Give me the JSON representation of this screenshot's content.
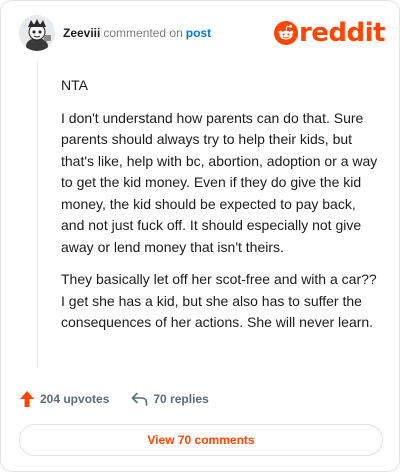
{
  "header": {
    "username": "Zeeviii",
    "action_text": "commented on",
    "post_link": "post",
    "brand": "reddit"
  },
  "comment": {
    "paragraphs": [
      "NTA",
      "I don't understand how parents can do that. Sure parents should always try to help their kids, but that's like, help with bc, abortion, adoption or a way to get the kid money. Even if they do give the kid money, the kid should be expected to pay back, and not just fuck off. It should especially not give away or lend money that isn't theirs.",
      "They basically let off her scot-free and with a car?? I get she has a kid, but she also has to suffer the consequences of her actions. She will never learn."
    ]
  },
  "stats": {
    "upvotes": "204 upvotes",
    "replies": "70 replies"
  },
  "footer": {
    "view_comments": "View 70 comments"
  },
  "colors": {
    "brand_orange": "#ff4500",
    "link_blue": "#0079d3",
    "meta_gray": "#576f76"
  },
  "icons": {
    "avatar": "snoo-avatar",
    "logo": "reddit-snoo-icon",
    "upvote": "upvote-arrow-icon",
    "reply": "reply-arrow-icon"
  }
}
